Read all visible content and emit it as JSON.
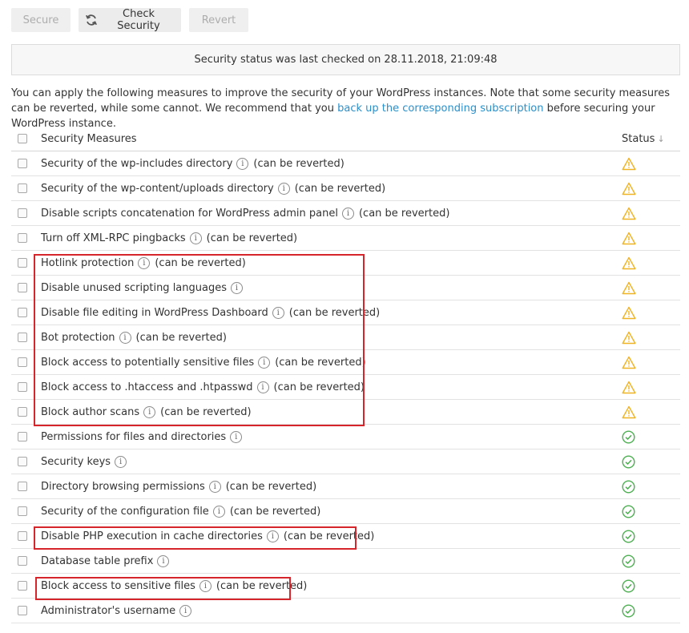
{
  "toolbar": {
    "secure_label": "Secure",
    "check_label": "Check Security",
    "revert_label": "Revert"
  },
  "status_message": "Security status was last checked on 28.11.2018, 21:09:48",
  "intro": {
    "text_before": "You can apply the following measures to improve the security of your WordPress instances. Note that some security measures can be reverted, while some cannot. We recommend that you ",
    "link_text": "back up the corresponding subscription",
    "text_after": " before securing your WordPress instance."
  },
  "table": {
    "col_measures": "Security Measures",
    "col_status": "Status",
    "rows": [
      {
        "name": "Security of the wp-includes directory",
        "note": "(can be reverted)",
        "status": "warning"
      },
      {
        "name": "Security of the wp-content/uploads directory",
        "note": "(can be reverted)",
        "status": "warning"
      },
      {
        "name": "Disable scripts concatenation for WordPress admin panel",
        "note": "(can be reverted)",
        "status": "warning"
      },
      {
        "name": "Turn off XML-RPC pingbacks",
        "note": "(can be reverted)",
        "status": "warning"
      },
      {
        "name": "Hotlink protection",
        "note": "(can be reverted)",
        "status": "warning"
      },
      {
        "name": "Disable unused scripting languages",
        "note": "",
        "status": "warning"
      },
      {
        "name": "Disable file editing in WordPress Dashboard",
        "note": "(can be reverted)",
        "status": "warning"
      },
      {
        "name": "Bot protection",
        "note": "(can be reverted)",
        "status": "warning"
      },
      {
        "name": "Block access to potentially sensitive files",
        "note": "(can be reverted)",
        "status": "warning"
      },
      {
        "name": "Block access to .htaccess and .htpasswd",
        "note": "(can be reverted)",
        "status": "warning"
      },
      {
        "name": "Block author scans",
        "note": "(can be reverted)",
        "status": "warning"
      },
      {
        "name": "Permissions for files and directories",
        "note": "",
        "status": "ok"
      },
      {
        "name": "Security keys",
        "note": "",
        "status": "ok"
      },
      {
        "name": "Directory browsing permissions",
        "note": "(can be reverted)",
        "status": "ok"
      },
      {
        "name": "Security of the configuration file",
        "note": "(can be reverted)",
        "status": "ok"
      },
      {
        "name": "Disable PHP execution in cache directories",
        "note": "(can be reverted)",
        "status": "ok"
      },
      {
        "name": "Database table prefix",
        "note": "",
        "status": "ok"
      },
      {
        "name": "Block access to sensitive files",
        "note": "(can be reverted)",
        "status": "ok"
      },
      {
        "name": "Administrator's username",
        "note": "",
        "status": "ok"
      }
    ]
  },
  "colors": {
    "warning": "#f0b323",
    "ok": "#4caf50",
    "link": "#2b8fc9",
    "highlight": "#d7262b"
  }
}
